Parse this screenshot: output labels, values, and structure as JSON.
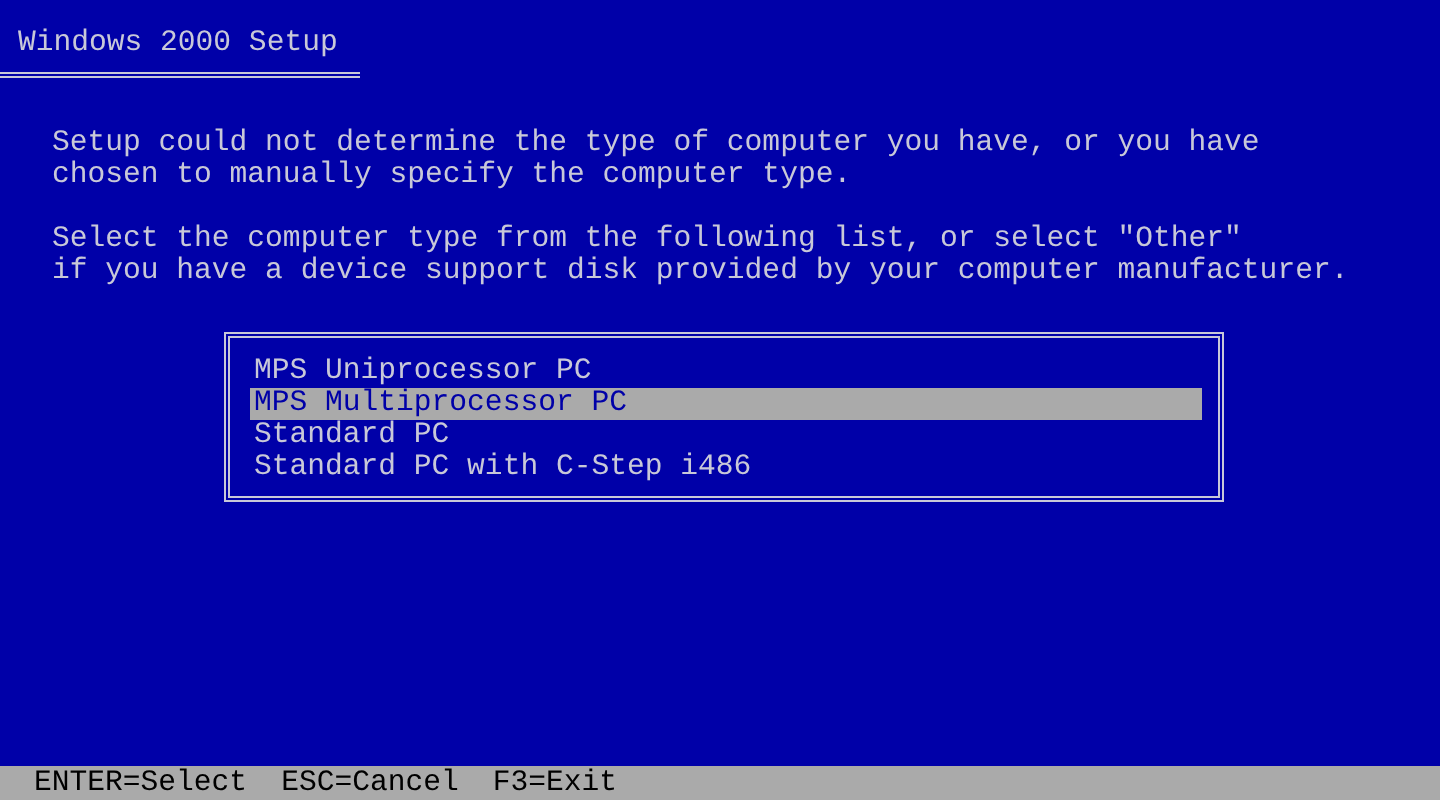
{
  "window": {
    "title": "Windows 2000 Setup"
  },
  "paragraphs": [
    "Setup could not determine the type of computer you have, or you have\nchosen to manually specify the computer type.",
    "Select the computer type from the following list, or select \"Other\"\nif you have a device support disk provided by your computer manufacturer."
  ],
  "list": {
    "items": [
      {
        "label": "MPS Uniprocessor PC",
        "selected": false
      },
      {
        "label": "MPS Multiprocessor PC",
        "selected": true
      },
      {
        "label": "Standard PC",
        "selected": false
      },
      {
        "label": "Standard PC with C-Step i486",
        "selected": false
      }
    ]
  },
  "status_bar": [
    "ENTER=Select",
    "ESC=Cancel",
    "F3=Exit"
  ]
}
